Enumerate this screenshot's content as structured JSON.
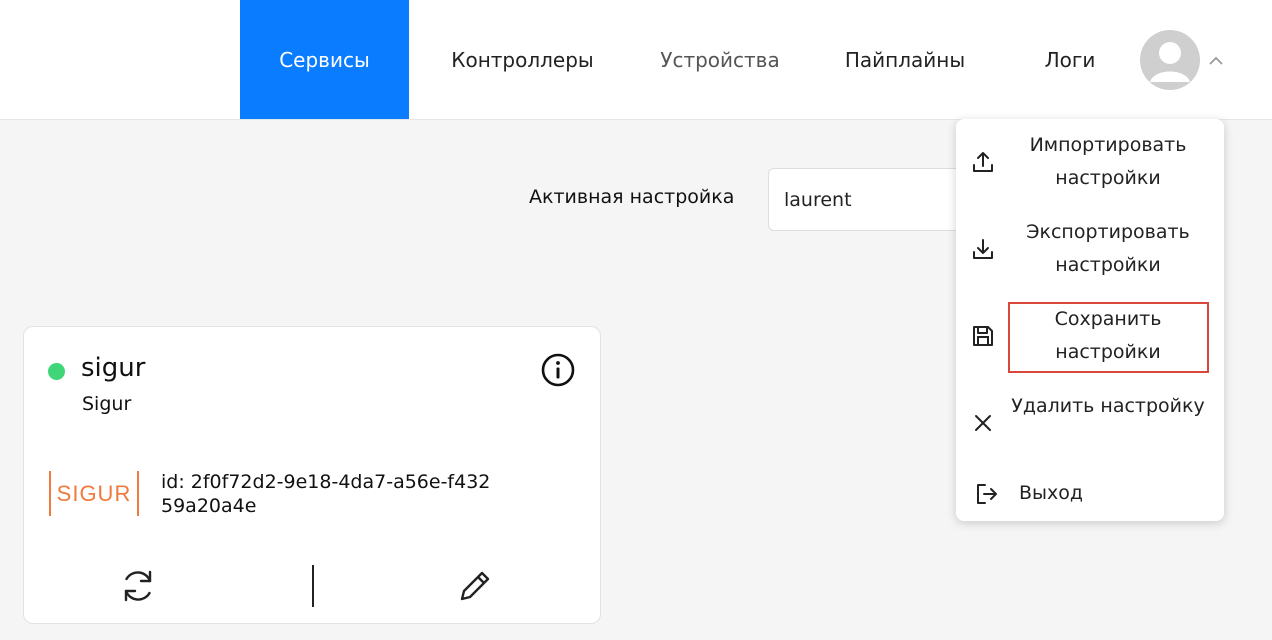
{
  "nav": {
    "tabs": [
      {
        "label": "Сервисы",
        "active": true
      },
      {
        "label": "Контроллеры"
      },
      {
        "label": "Устройства"
      },
      {
        "label": "Пайплайны"
      },
      {
        "label": "Логи"
      }
    ],
    "avatar_icon": "user-avatar-icon",
    "chevron_icon": "chevron-up-icon"
  },
  "settings": {
    "active_label": "Активная настройка",
    "active_value": "laurent"
  },
  "service_card": {
    "title": "sigur",
    "subtitle": "Sigur",
    "status_color": "#3fd67a",
    "logo_text": "SIGUR",
    "id_text": "id: 2f0f72d2-9e18-4da7-a56e-f43259a20a4e"
  },
  "menu": {
    "items": [
      {
        "label": "Импортировать настройки",
        "icon": "upload-icon"
      },
      {
        "label": "Экспортировать настройки",
        "icon": "download-icon"
      },
      {
        "label": "Сохранить настройки",
        "icon": "save-icon",
        "highlighted": true
      },
      {
        "label": "Удалить настройку",
        "icon": "close-icon"
      },
      {
        "label": "Выход",
        "icon": "logout-icon"
      }
    ]
  },
  "colors": {
    "accent": "#0a7cff",
    "highlight": "#d9463c",
    "logo": "#f07a3e"
  }
}
